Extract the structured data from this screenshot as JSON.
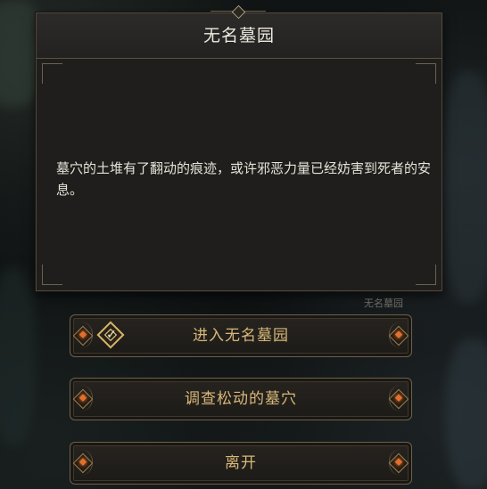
{
  "event": {
    "title": "无名墓园",
    "description": "墓穴的土堆有了翻动的痕迹，或许邪恶力量已经妨害到死者的安息。",
    "location_label": "无名墓园"
  },
  "choices": [
    {
      "label": "进入无名墓园",
      "icon": "quest-check-icon"
    },
    {
      "label": "调查松动的墓穴"
    },
    {
      "label": "离开"
    }
  ],
  "colors": {
    "accent_gold": "#d8b878",
    "ember": "#e0702c",
    "panel_bg": "#1f1e1c"
  }
}
